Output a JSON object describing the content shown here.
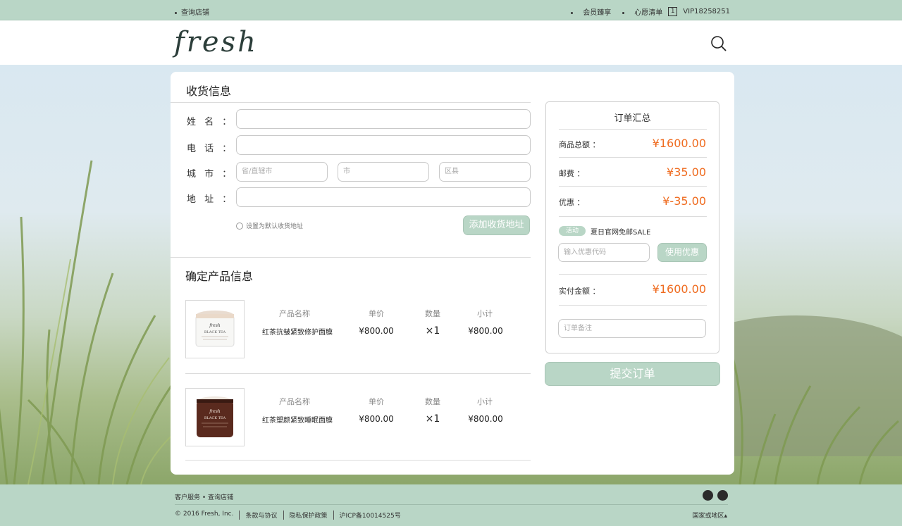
{
  "topbar": {
    "store_link": "查询店铺",
    "member_link": "会员臻享",
    "wishlist_link": "心愿清单",
    "cart_count": "1",
    "vip_account": "VIP18258251"
  },
  "header": {
    "logo": "fresh"
  },
  "shipping": {
    "title": "收货信息",
    "name_label": "姓 名 ：",
    "phone_label": "电 话 ：",
    "city_label": "城 市 ：",
    "address_label": "地 址 ：",
    "province_placeholder": "省/直辖市",
    "city_placeholder": "市",
    "district_placeholder": "区县",
    "default_checkbox": "设置为默认收货地址",
    "add_address_button": "添加收货地址"
  },
  "products": {
    "title": "确定产品信息",
    "col_name": "产品名称",
    "col_price": "单价",
    "col_qty": "数量",
    "col_subtotal": "小计",
    "items": [
      {
        "name": "红茶抗皱紧致修护面膜",
        "price": "¥800.00",
        "qty": "×1",
        "subtotal": "¥800.00"
      },
      {
        "name": "红茶塑颜紧致睡眠面膜",
        "price": "¥800.00",
        "qty": "×1",
        "subtotal": "¥800.00"
      }
    ]
  },
  "summary": {
    "title": "订单汇总",
    "goods_total_label": "商品总额 ：",
    "goods_total_value": "¥1600.00",
    "shipping_label": "邮费 ：",
    "shipping_value": "¥35.00",
    "discount_label": "优惠 ：",
    "discount_value": "¥-35.00",
    "promo_tag": "活动",
    "promo_text": "夏日官网免邮SALE",
    "coupon_placeholder": "输入优惠代码",
    "coupon_button": "使用优惠",
    "actual_label": "实付金额 ：",
    "actual_value": "¥1600.00",
    "note_placeholder": "订单备注",
    "submit_button": "提交订单"
  },
  "footer": {
    "top_links": "客户服务 • 查询店铺",
    "copyright": "© 2016 Fresh, Inc.",
    "terms": "条款与协议",
    "privacy": "隐私保护政策",
    "icp": "沪ICP备10014525号",
    "region": "国家或地区▴"
  },
  "colors": {
    "accent": "#b9d6c6",
    "price": "#ef6b1f"
  },
  "icons": [
    "search-icon",
    "weibo-icon",
    "wechat-icon"
  ]
}
